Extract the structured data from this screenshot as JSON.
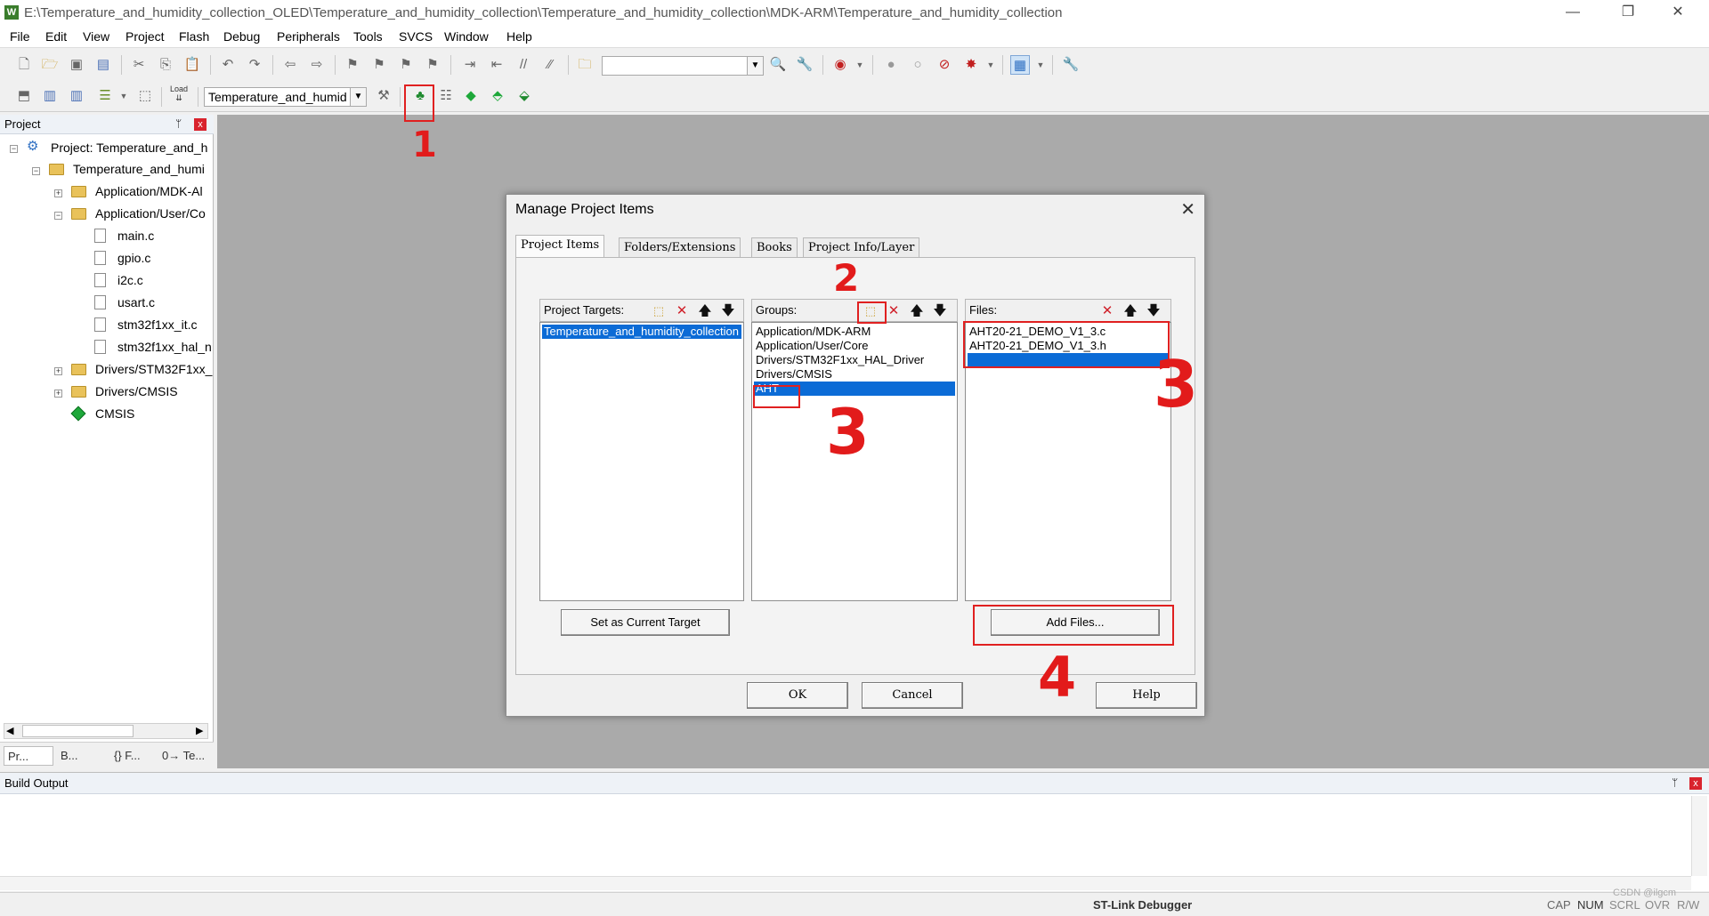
{
  "window": {
    "title": "E:\\Temperature_and_humidity_collection_OLED\\Temperature_and_humidity_collection\\Temperature_and_humidity_collection\\MDK-ARM\\Temperature_and_humidity_collection",
    "app_icon": "W",
    "minimize": "—",
    "maximize": "❐",
    "close": "✕"
  },
  "menu": [
    "File",
    "Edit",
    "View",
    "Project",
    "Flash",
    "Debug",
    "Peripherals",
    "Tools",
    "SVCS",
    "Window",
    "Help"
  ],
  "toolbar2": {
    "target_combo": "Temperature_and_humid",
    "load_label": "Load"
  },
  "project_panel": {
    "title": "Project",
    "pin": "ᛘ",
    "close": "x",
    "tree": [
      {
        "label": "Project: Temperature_and_h"
      },
      {
        "label": "Temperature_and_humi"
      },
      {
        "label": "Application/MDK-Al"
      },
      {
        "label": "Application/User/Co"
      },
      {
        "label": "main.c"
      },
      {
        "label": "gpio.c"
      },
      {
        "label": "i2c.c"
      },
      {
        "label": "usart.c"
      },
      {
        "label": "stm32f1xx_it.c"
      },
      {
        "label": "stm32f1xx_hal_n"
      },
      {
        "label": "Drivers/STM32F1xx_"
      },
      {
        "label": "Drivers/CMSIS"
      },
      {
        "label": "CMSIS"
      }
    ],
    "tabs": [
      "Pr...",
      "B...",
      "{} F...",
      "0→ Te..."
    ]
  },
  "build_output": {
    "title": "Build Output",
    "close": "x"
  },
  "status_bar": {
    "debugger": "ST-Link Debugger",
    "cap": "CAP",
    "num": "NUM",
    "scrl": "SCRL",
    "ovr": "OVR",
    "rw": "R/W",
    "watermark": "CSDN @ilgcm"
  },
  "dialog": {
    "title": "Manage Project Items",
    "close": "✕",
    "tabs": [
      "Project Items",
      "Folders/Extensions",
      "Books",
      "Project Info/Layer"
    ],
    "targets_header": "Project Targets:",
    "targets": [
      "Temperature_and_humidity_collection"
    ],
    "groups_header": "Groups:",
    "groups": [
      "Application/MDK-ARM",
      "Application/User/Core",
      "Drivers/STM32F1xx_HAL_Driver",
      "Drivers/CMSIS",
      "AHT"
    ],
    "files_header": "Files:",
    "files": [
      "AHT20-21_DEMO_V1_3.c",
      "AHT20-21_DEMO_V1_3.h"
    ],
    "set_target_button": "Set as Current Target",
    "add_files_button": "Add Files...",
    "ok_button": "OK",
    "cancel_button": "Cancel",
    "help_button": "Help"
  },
  "annotations": [
    "1",
    "2",
    "3",
    "3",
    "4"
  ],
  "colors": {
    "selection": "#0b6bd6",
    "annotation_red": "#e21b1b",
    "editor_bg": "#aaaaaa"
  }
}
